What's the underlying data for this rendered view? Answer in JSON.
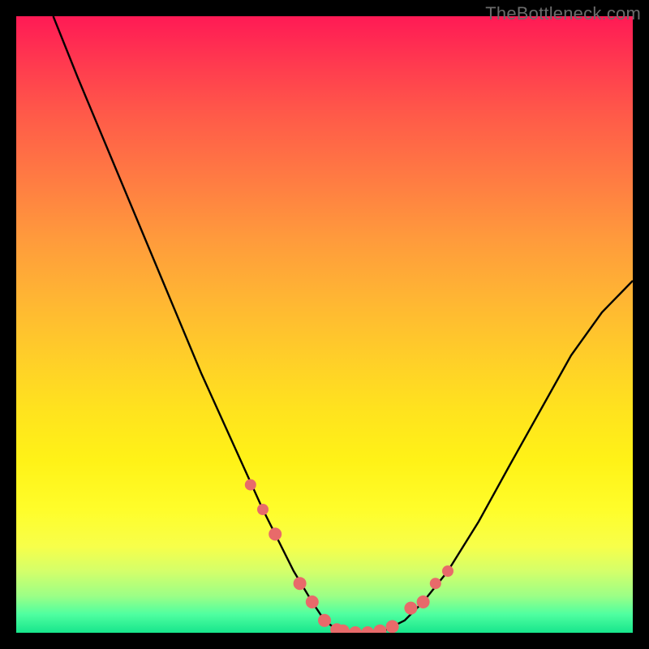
{
  "watermark": "TheBottleneck.com",
  "chart_data": {
    "type": "line",
    "title": "",
    "xlabel": "",
    "ylabel": "",
    "xlim": [
      0,
      100
    ],
    "ylim": [
      0,
      100
    ],
    "grid": false,
    "legend": false,
    "background_gradient": {
      "stops": [
        {
          "pos": 0,
          "color": "#ff1a55"
        },
        {
          "pos": 26,
          "color": "#ff7a43"
        },
        {
          "pos": 56,
          "color": "#ffd028"
        },
        {
          "pos": 80,
          "color": "#fffd2a"
        },
        {
          "pos": 94,
          "color": "#9cff86"
        },
        {
          "pos": 100,
          "color": "#17e58c"
        }
      ]
    },
    "series": [
      {
        "name": "bottleneck-curve",
        "stroke": "#000000",
        "x": [
          6,
          10,
          15,
          20,
          25,
          30,
          35,
          40,
          45,
          48,
          50,
          52,
          55,
          58,
          60,
          63,
          66,
          70,
          75,
          80,
          85,
          90,
          95,
          100
        ],
        "y": [
          100,
          90,
          78,
          66,
          54,
          42,
          31,
          20,
          10,
          5,
          2,
          0.5,
          0,
          0,
          0.5,
          2,
          5,
          10,
          18,
          27,
          36,
          45,
          52,
          57
        ]
      },
      {
        "name": "highlight-dots",
        "stroke": "#e86a6a",
        "marker": "circle",
        "x": [
          38,
          40,
          42,
          46,
          48,
          50,
          52,
          53,
          55,
          57,
          59,
          61,
          64,
          66,
          68,
          70
        ],
        "y": [
          24,
          20,
          16,
          8,
          5,
          2,
          0.5,
          0.3,
          0,
          0,
          0.3,
          1,
          4,
          5,
          8,
          10
        ]
      }
    ],
    "annotations": []
  }
}
